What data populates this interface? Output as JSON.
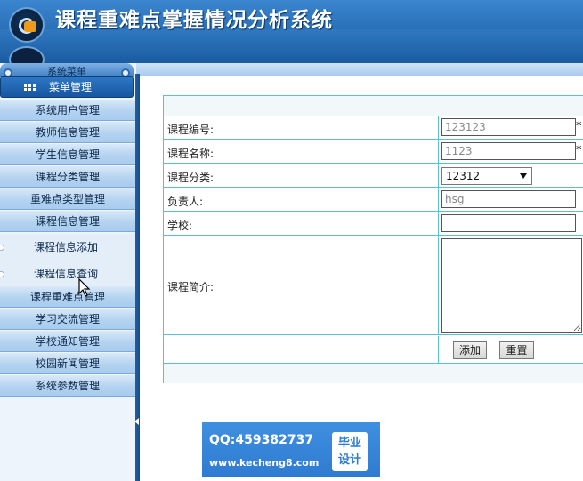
{
  "header": {
    "title": "课程重难点掌握情况分析系统"
  },
  "sidebar": {
    "menu_top_label": "系统菜单",
    "menu_head_label": "菜单管理",
    "items": [
      {
        "label": "系统用户管理"
      },
      {
        "label": "教师信息管理"
      },
      {
        "label": "学生信息管理"
      },
      {
        "label": "课程分类管理"
      },
      {
        "label": "重难点类型管理"
      },
      {
        "label": "课程信息管理"
      }
    ],
    "sub_items": [
      {
        "label": "课程信息添加"
      },
      {
        "label": "课程信息查询"
      }
    ],
    "items_after": [
      {
        "label": "课程重难点管理"
      },
      {
        "label": "学习交流管理"
      },
      {
        "label": "学校通知管理"
      },
      {
        "label": "校园新闻管理"
      },
      {
        "label": "系统参数管理"
      }
    ]
  },
  "form": {
    "course_code": {
      "label": "课程编号:",
      "value": "123123",
      "required_mark": "*"
    },
    "course_name": {
      "label": "课程名称:",
      "value": "1123",
      "required_mark": "*"
    },
    "course_category": {
      "label": "课程分类:",
      "selected": "12312"
    },
    "owner": {
      "label": "负责人:",
      "value": "hsg"
    },
    "school": {
      "label": "学校:",
      "value": ""
    },
    "intro": {
      "label": "课程简介:",
      "value": ""
    },
    "buttons": {
      "add": "添加",
      "reset": "重置"
    }
  },
  "watermark": {
    "qq": "QQ:459382737",
    "url": "www.kecheng8.com",
    "badge_line1": "毕业",
    "badge_line2": "设计"
  }
}
